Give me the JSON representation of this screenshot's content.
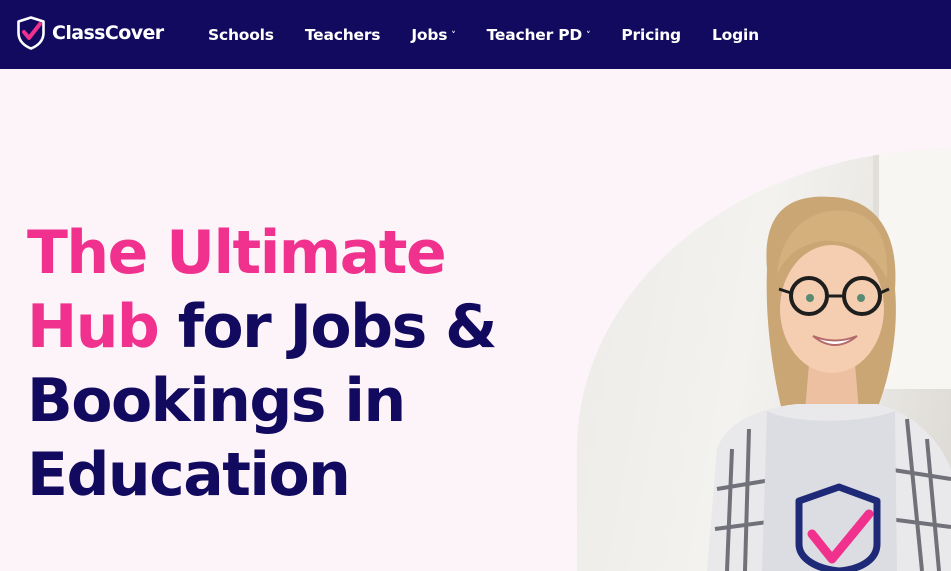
{
  "header": {
    "logo_text": "ClassCover",
    "nav": [
      {
        "label": "Schools",
        "has_dropdown": false
      },
      {
        "label": "Teachers",
        "has_dropdown": false
      },
      {
        "label": "Jobs",
        "has_dropdown": true
      },
      {
        "label": "Teacher PD",
        "has_dropdown": true
      },
      {
        "label": "Pricing",
        "has_dropdown": false
      },
      {
        "label": "Login",
        "has_dropdown": false
      }
    ],
    "chevron": "˅"
  },
  "hero": {
    "title_part1": "The Ultimate",
    "title_part2": "Hub",
    "title_part3": "for Jobs &",
    "title_part4": "Bookings in",
    "title_part5": "Education"
  },
  "colors": {
    "nav_bg": "#120a5e",
    "accent_pink": "#f0328e",
    "heading_navy": "#120a5e",
    "page_bg": "#fdf4fa"
  }
}
